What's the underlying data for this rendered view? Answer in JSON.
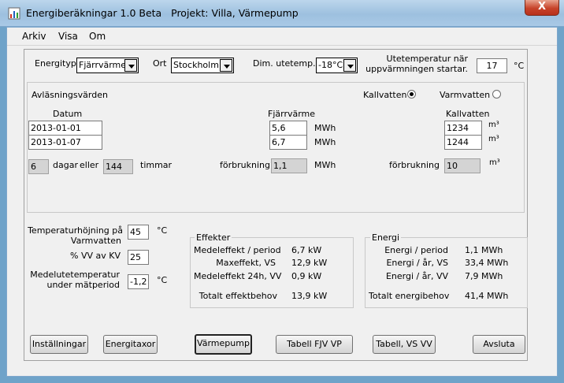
{
  "window": {
    "title": "Energiberäkningar 1.0 Beta   Projekt: Villa, Värmepump",
    "close_glyph": "X"
  },
  "menu": [
    "Arkiv",
    "Visa",
    "Om"
  ],
  "settings": {
    "energityp_label": "Energityp",
    "energityp_value": "Fjärrvärme",
    "ort_label": "Ort",
    "ort_value": "Stockholm",
    "dim_label": "Dim. utetemp.",
    "dim_value": "-18°C",
    "utetemp_label_1": "Utetemperatur när",
    "utetemp_label_2": "uppvärmningen startar.",
    "utetemp_value": "17",
    "utetemp_unit": "°C"
  },
  "readings": {
    "title": "Avläsningsvärden",
    "radio_kallvatten": "Kallvatten",
    "radio_varmvatten": "Varmvatten",
    "datum_header": "Datum",
    "fjarrvarme_header": "Fjärrvärme",
    "kallvatten_header": "Kallvatten",
    "dates": [
      "2013-01-01",
      "2013-01-07"
    ],
    "fjarrvarme": [
      "5,6",
      "6,7"
    ],
    "fjarrvarme_unit": "MWh",
    "kallvatten": [
      "1234",
      "1244"
    ],
    "kallvatten_unit": "m³",
    "days": "6",
    "days_label": "dagar",
    "eller": "eller",
    "hours": "144",
    "hours_label": "timmar",
    "forbrukning_label": "förbrukning",
    "fjv_forbrukning": "1,1",
    "fjv_forbrukning_unit": "MWh",
    "kv_forbrukning": "10",
    "kv_forbrukning_unit": "m³"
  },
  "params": {
    "temp_rise_label_1": "Temperaturhöjning på",
    "temp_rise_label_2": "Varmvatten",
    "temp_rise_value": "45",
    "temp_rise_unit": "°C",
    "vv_label": "% VV av KV",
    "vv_value": "25",
    "medel_label_1": "Medelutetemperatur",
    "medel_label_2": "under mätperiod",
    "medel_value": "-1,2",
    "medel_unit": "°C"
  },
  "effekter": {
    "title": "Effekter",
    "rows": [
      {
        "label": "Medeleffekt / period",
        "value": "6,7 kW"
      },
      {
        "label": "Maxeffekt, VS",
        "value": "12,9 kW"
      },
      {
        "label": "Medeleffekt 24h, VV",
        "value": "0,9 kW"
      }
    ],
    "total_label": "Totalt effektbehov",
    "total_value": "13,9 kW"
  },
  "energi": {
    "title": "Energi",
    "rows": [
      {
        "label": "Energi / period",
        "value": "1,1 MWh"
      },
      {
        "label": "Energi / år, VS",
        "value": "33,4 MWh"
      },
      {
        "label": "Energi / år, VV",
        "value": "7,9 MWh"
      }
    ],
    "total_label": "Totalt energibehov",
    "total_value": "41,4 MWh"
  },
  "buttons": {
    "installningar": "Inställningar",
    "energitaxor": "Energitaxor",
    "varmepump": "Värmepump",
    "tabell_fjv_vp": "Tabell FJV VP",
    "tabell_vs_vv": "Tabell, VS VV",
    "avsluta": "Avsluta"
  },
  "colors": {
    "titlebar": "#a9c9e6",
    "close": "#c7432a",
    "window_bg": "#f0f0f0",
    "readonly": "#d4d4d4"
  }
}
